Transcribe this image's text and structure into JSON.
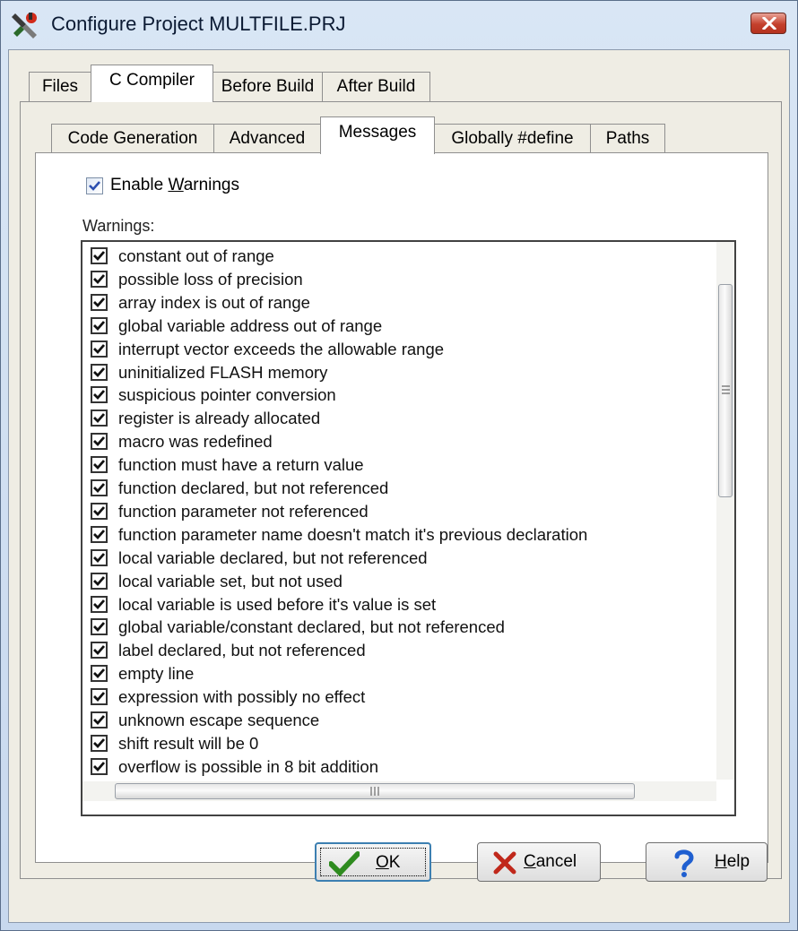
{
  "window": {
    "title": "Configure Project MULTFILE.PRJ"
  },
  "outer_tabs": [
    {
      "label": "Files",
      "active": false
    },
    {
      "label": "C Compiler",
      "active": true
    },
    {
      "label": "Before Build",
      "active": false
    },
    {
      "label": "After Build",
      "active": false
    }
  ],
  "inner_tabs": [
    {
      "label": "Code Generation",
      "active": false
    },
    {
      "label": "Advanced",
      "active": false
    },
    {
      "label": "Messages",
      "active": true
    },
    {
      "label": "Globally #define",
      "active": false
    },
    {
      "label": "Paths",
      "active": false
    }
  ],
  "messages": {
    "enable_warnings": {
      "label_pre": "Enable ",
      "mnemonic": "W",
      "label_post": "arnings",
      "checked": true
    },
    "warnings_label": "Warnings:",
    "warnings": [
      {
        "label": "constant out of range",
        "checked": true
      },
      {
        "label": "possible loss of precision",
        "checked": true
      },
      {
        "label": "array index is out of range",
        "checked": true
      },
      {
        "label": "global variable address out of range",
        "checked": true
      },
      {
        "label": "interrupt vector exceeds the allowable range",
        "checked": true
      },
      {
        "label": "uninitialized FLASH memory",
        "checked": true
      },
      {
        "label": "suspicious pointer conversion",
        "checked": true
      },
      {
        "label": "register is already allocated",
        "checked": true
      },
      {
        "label": "macro was redefined",
        "checked": true
      },
      {
        "label": "function must have a return value",
        "checked": true
      },
      {
        "label": "function declared, but not referenced",
        "checked": true
      },
      {
        "label": "function parameter not referenced",
        "checked": true
      },
      {
        "label": "function parameter name doesn't match it's previous declaration",
        "checked": true
      },
      {
        "label": "local variable declared, but not referenced",
        "checked": true
      },
      {
        "label": "local variable set, but not used",
        "checked": true
      },
      {
        "label": "local variable is used before it's value is set",
        "checked": true
      },
      {
        "label": "global variable/constant declared, but not referenced",
        "checked": true
      },
      {
        "label": "label declared, but not referenced",
        "checked": true
      },
      {
        "label": "empty line",
        "checked": true
      },
      {
        "label": "expression with possibly no effect",
        "checked": true
      },
      {
        "label": "unknown escape sequence",
        "checked": true
      },
      {
        "label": "shift result will be 0",
        "checked": true
      },
      {
        "label": "overflow is possible in 8 bit addition",
        "checked": true
      }
    ]
  },
  "buttons": {
    "ok": {
      "mnemonic": "O",
      "rest": "K",
      "icon": "check-icon"
    },
    "cancel": {
      "mnemonic": "C",
      "rest": "ancel",
      "icon": "x-icon"
    },
    "help": {
      "mnemonic": "H",
      "rest": "elp",
      "icon": "question-icon"
    }
  },
  "colors": {
    "ok_icon": "#2e8b1f",
    "cancel_icon": "#c0281b",
    "help_icon": "#1f5fd0"
  }
}
